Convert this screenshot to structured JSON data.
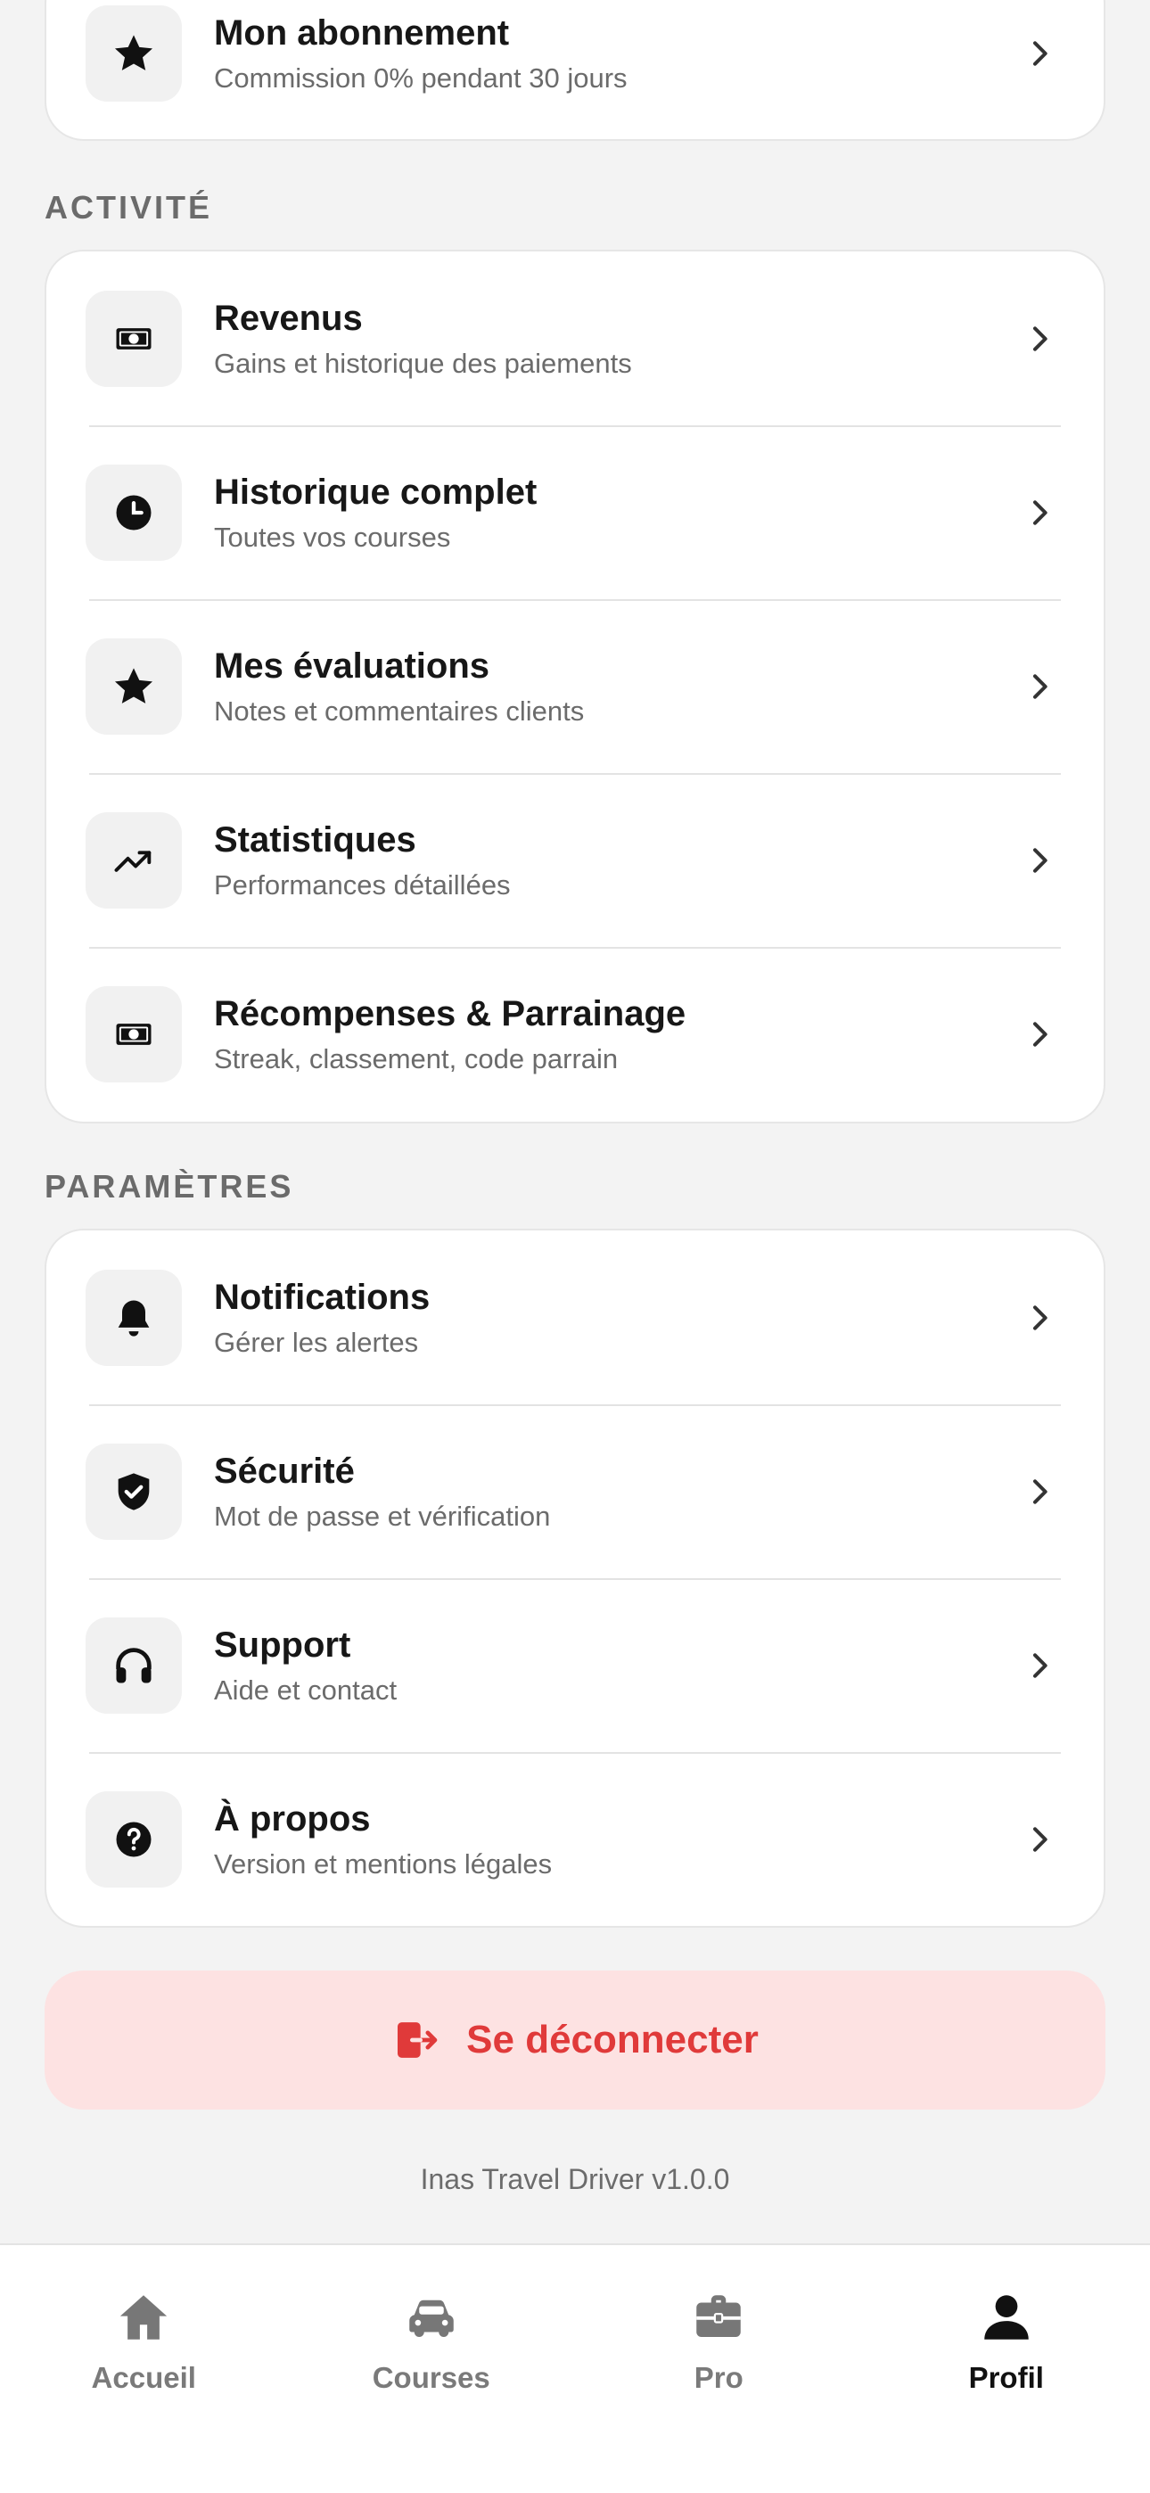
{
  "subscription": {
    "title": "Mon abonnement",
    "subtitle": "Commission 0% pendant 30 jours",
    "icon": "star-icon"
  },
  "sections": {
    "activity": {
      "label": "ACTIVITÉ",
      "items": [
        {
          "title": "Revenus",
          "subtitle": "Gains et historique des paiements",
          "icon": "cash-icon"
        },
        {
          "title": "Historique complet",
          "subtitle": "Toutes vos courses",
          "icon": "clock-icon"
        },
        {
          "title": "Mes évaluations",
          "subtitle": "Notes et commentaires clients",
          "icon": "star-icon"
        },
        {
          "title": "Statistiques",
          "subtitle": "Performances détaillées",
          "icon": "trending-up-icon"
        },
        {
          "title": "Récompenses & Parrainage",
          "subtitle": "Streak, classement, code parrain",
          "icon": "cash-icon"
        }
      ]
    },
    "settings": {
      "label": "PARAMÈTRES",
      "items": [
        {
          "title": "Notifications",
          "subtitle": "Gérer les alertes",
          "icon": "bell-icon"
        },
        {
          "title": "Sécurité",
          "subtitle": "Mot de passe et vérification",
          "icon": "shield-check-icon"
        },
        {
          "title": "Support",
          "subtitle": "Aide et contact",
          "icon": "headphones-icon"
        },
        {
          "title": "À propos",
          "subtitle": "Version et mentions légales",
          "icon": "help-circle-icon"
        }
      ]
    }
  },
  "logout": {
    "label": "Se déconnecter",
    "icon": "logout-icon",
    "color": "#e03a3a",
    "background": "#fde2e2"
  },
  "version": "Inas Travel Driver v1.0.0",
  "tabbar": {
    "tabs": [
      {
        "label": "Accueil",
        "icon": "home-icon"
      },
      {
        "label": "Courses",
        "icon": "car-icon"
      },
      {
        "label": "Pro",
        "icon": "briefcase-icon"
      },
      {
        "label": "Profil",
        "icon": "person-icon",
        "active": true
      }
    ]
  }
}
